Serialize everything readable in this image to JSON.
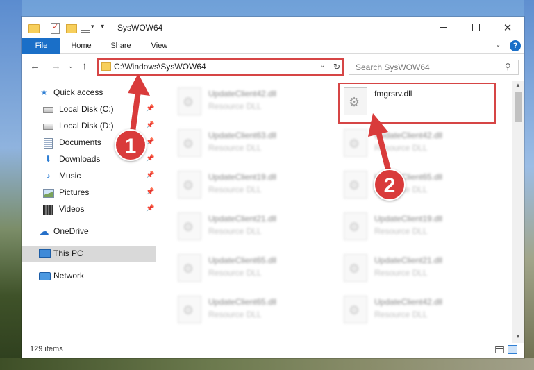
{
  "window": {
    "title": "SysWOW64",
    "controls": {
      "minimize": "",
      "maximize": "",
      "close": "✕"
    }
  },
  "quick_access_toolbar": {
    "dropdown": "▾",
    "customize": "▾"
  },
  "ribbon": {
    "tabs": [
      {
        "label": "File"
      },
      {
        "label": "Home"
      },
      {
        "label": "Share"
      },
      {
        "label": "View"
      }
    ],
    "expand": "⌄",
    "help": "?"
  },
  "navigation": {
    "back": "←",
    "forward": "→",
    "recent": "⌄",
    "up": "↑",
    "address": "C:\\Windows\\SysWOW64",
    "address_dropdown": "⌄",
    "refresh": "↻",
    "search_placeholder": "Search SysWOW64",
    "search_icon": "⚲"
  },
  "sidebar": {
    "items": [
      {
        "label": "Quick access",
        "icon": "star-icon",
        "pinned": false
      },
      {
        "label": "Local Disk (C:)",
        "icon": "drive-icon",
        "pinned": true
      },
      {
        "label": "Local Disk (D:)",
        "icon": "drive-icon",
        "pinned": true
      },
      {
        "label": "Documents",
        "icon": "documents-icon",
        "pinned": true
      },
      {
        "label": "Downloads",
        "icon": "downloads-icon",
        "pinned": true
      },
      {
        "label": "Music",
        "icon": "music-icon",
        "pinned": true
      },
      {
        "label": "Pictures",
        "icon": "pictures-icon",
        "pinned": true
      },
      {
        "label": "Videos",
        "icon": "videos-icon",
        "pinned": true
      },
      {
        "label": "OneDrive",
        "icon": "onedrive-icon",
        "pinned": false
      },
      {
        "label": "This PC",
        "icon": "this-pc-icon",
        "pinned": false,
        "selected": true
      },
      {
        "label": "Network",
        "icon": "network-icon",
        "pinned": false
      }
    ],
    "pin_glyph": "📌"
  },
  "files": {
    "left_column": [
      {
        "name": "UpdateClient42.dll",
        "type": "Resource DLL"
      },
      {
        "name": "UpdateClient63.dll",
        "type": "Resource DLL"
      },
      {
        "name": "UpdateClient19.dll",
        "type": "Resource DLL"
      },
      {
        "name": "UpdateClient21.dll",
        "type": "Resource DLL"
      },
      {
        "name": "UpdateClient65.dll",
        "type": "Resource DLL"
      },
      {
        "name": "UpdateClient65.dll",
        "type": "Resource DLL"
      }
    ],
    "right_column": [
      {
        "name": "fmgrsrv.dll",
        "type": ""
      },
      {
        "name": "UpdateClient42.dll",
        "type": "Resource DLL"
      },
      {
        "name": "UpdateClient65.dll",
        "type": "Resource DLL"
      },
      {
        "name": "UpdateClient19.dll",
        "type": "Resource DLL"
      },
      {
        "name": "UpdateClient21.dll",
        "type": "Resource DLL"
      },
      {
        "name": "UpdateClient42.dll",
        "type": "Resource DLL"
      }
    ]
  },
  "scrollbar": {
    "up": "▲",
    "down": "▼"
  },
  "status": {
    "item_count": "129 items"
  },
  "callouts": {
    "one": "1",
    "two": "2"
  },
  "colors": {
    "accent": "#1a6fc8",
    "highlight": "#d64545",
    "callout": "#d93b3b"
  }
}
